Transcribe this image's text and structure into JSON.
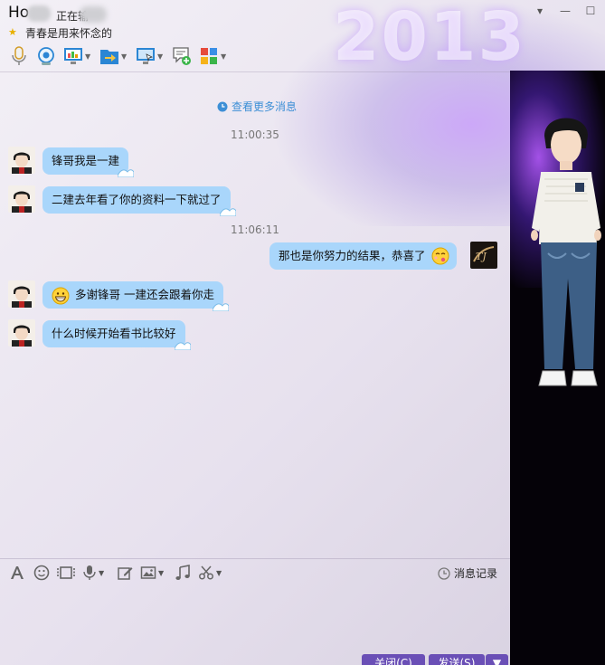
{
  "window": {
    "contact_name": "Ho",
    "typing_status": "正在输",
    "signature": "青春是用来怀念的",
    "year_text": "2013"
  },
  "toolbar": {
    "items": [
      {
        "icon": "microphone-icon",
        "has_dropdown": false
      },
      {
        "icon": "webcam-icon",
        "has_dropdown": false
      },
      {
        "icon": "screen-share-icon",
        "has_dropdown": true
      },
      {
        "icon": "send-file-icon",
        "has_dropdown": true
      },
      {
        "icon": "remote-desktop-icon",
        "has_dropdown": true
      },
      {
        "icon": "create-discussion-icon",
        "has_dropdown": false
      },
      {
        "icon": "apps-icon",
        "has_dropdown": true
      }
    ]
  },
  "chat": {
    "view_more": "查看更多消息",
    "timestamps": [
      "11:00:35",
      "11:06:11"
    ],
    "messages": [
      {
        "side": "left",
        "text": "锋哥我是一建"
      },
      {
        "side": "left",
        "text": "二建去年看了你的资料一下就过了"
      },
      {
        "side": "right",
        "text": "那也是你努力的结果，恭喜了"
      },
      {
        "side": "left",
        "text": "多谢锋哥  一建还会跟着你走",
        "emoji": "grin"
      },
      {
        "side": "left",
        "text": "什么时候开始看书比较好"
      }
    ]
  },
  "input_toolbar": {
    "history_label": "消息记录"
  },
  "buttons": {
    "close": "关闭(C)",
    "send": "发送(S)"
  },
  "colors": {
    "bubble": "#a9d6fb",
    "link": "#3d8fd6",
    "button": "#6a4fb6"
  }
}
